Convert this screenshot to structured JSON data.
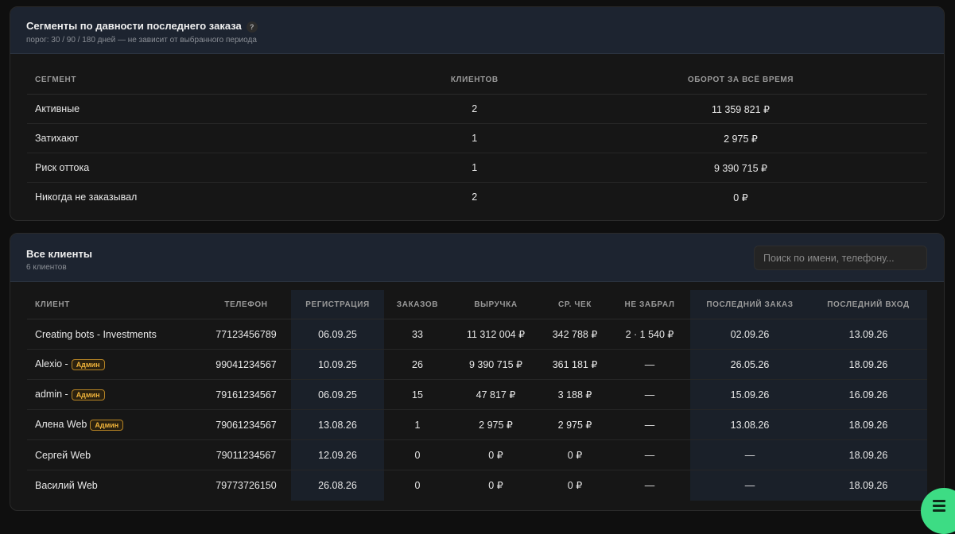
{
  "segments": {
    "title": "Сегменты по давности последнего заказа",
    "help": "?",
    "subtitle": "порог: 30 / 90 / 180 дней — не зависит от выбранного периода",
    "headers": {
      "segment": "Сегмент",
      "clients": "Клиентов",
      "turnover": "Оборот за всё время"
    },
    "rows": [
      {
        "segment": "Активные",
        "clients": "2",
        "turnover": "11 359 821 ₽"
      },
      {
        "segment": "Затихают",
        "clients": "1",
        "turnover": "2 975 ₽"
      },
      {
        "segment": "Риск оттока",
        "clients": "1",
        "turnover": "9 390 715 ₽"
      },
      {
        "segment": "Никогда не заказывал",
        "clients": "2",
        "turnover": "0 ₽"
      }
    ]
  },
  "clients": {
    "title": "Все клиенты",
    "subtitle": "6 клиентов",
    "search_placeholder": "Поиск по имени, телефону...",
    "headers": {
      "client": "Клиент",
      "phone": "Телефон",
      "registration": "Регистрация",
      "orders": "Заказов",
      "revenue": "Выручка",
      "avg_check": "Ср. чек",
      "not_picked": "Не забрал",
      "last_order": "Последний заказ",
      "last_login": "Последний вход"
    },
    "rows": [
      {
        "name": "Creating bots - Investments",
        "badge": "",
        "phone": "77123456789",
        "registration": "06.09.25",
        "orders": "33",
        "revenue": "11 312 004 ₽",
        "avg_check": "342 788 ₽",
        "not_picked": "2 · 1 540 ₽",
        "last_order": "02.09.26",
        "last_login": "13.09.26"
      },
      {
        "name": "Alexio -",
        "badge": "Админ",
        "phone": "99041234567",
        "registration": "10.09.25",
        "orders": "26",
        "revenue": "9 390 715 ₽",
        "avg_check": "361 181 ₽",
        "not_picked": "—",
        "last_order": "26.05.26",
        "last_login": "18.09.26"
      },
      {
        "name": "admin -",
        "badge": "Админ",
        "phone": "79161234567",
        "registration": "06.09.25",
        "orders": "15",
        "revenue": "47 817 ₽",
        "avg_check": "3 188 ₽",
        "not_picked": "—",
        "last_order": "15.09.26",
        "last_login": "16.09.26"
      },
      {
        "name": "Алена Web",
        "badge": "Админ",
        "phone": "79061234567",
        "registration": "13.08.26",
        "orders": "1",
        "revenue": "2 975 ₽",
        "avg_check": "2 975 ₽",
        "not_picked": "—",
        "last_order": "13.08.26",
        "last_login": "18.09.26"
      },
      {
        "name": "Сергей Web",
        "badge": "",
        "phone": "79011234567",
        "registration": "12.09.26",
        "orders": "0",
        "revenue": "0 ₽",
        "avg_check": "0 ₽",
        "not_picked": "—",
        "last_order": "—",
        "last_login": "18.09.26"
      },
      {
        "name": "Василий Web",
        "badge": "",
        "phone": "79773726150",
        "registration": "26.08.26",
        "orders": "0",
        "revenue": "0 ₽",
        "avg_check": "0 ₽",
        "not_picked": "—",
        "last_order": "—",
        "last_login": "18.09.26"
      }
    ]
  },
  "fab_icon": "menu-icon"
}
